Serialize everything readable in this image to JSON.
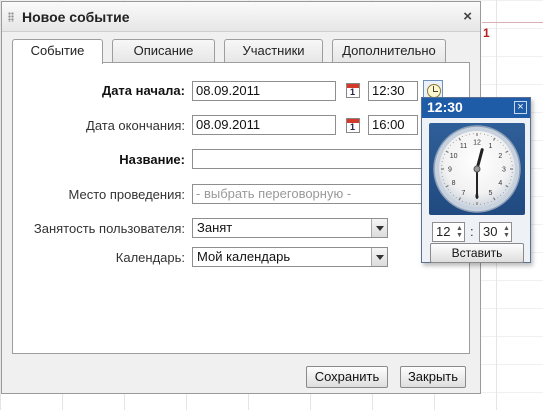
{
  "background": {
    "calendar_day_number": "1"
  },
  "dialog": {
    "title": "Новое событие",
    "close_symbol": "×",
    "tabs": [
      {
        "label": "Событие",
        "active": true
      },
      {
        "label": "Описание",
        "active": false
      },
      {
        "label": "Участники",
        "active": false
      },
      {
        "label": "Дополнительно",
        "active": false
      }
    ],
    "form": {
      "start_date_label": "Дата начала:",
      "start_date_value": "08.09.2011",
      "start_time_value": "12:30",
      "end_date_label": "Дата окончания:",
      "end_date_value": "08.09.2011",
      "end_time_value": "16:00",
      "calendar_icon_text": "1",
      "title_label": "Название:",
      "title_value": "",
      "place_label": "Место проведения:",
      "place_placeholder": "- выбрать переговорную -",
      "busy_label": "Занятость пользователя:",
      "busy_value": "Занят",
      "calendar_label": "Календарь:",
      "calendar_value": "Мой календарь"
    },
    "buttons": {
      "save": "Сохранить",
      "close": "Закрыть"
    }
  },
  "clock_popup": {
    "time": "12:30",
    "close_symbol": "×",
    "hours": "12",
    "minutes": "30",
    "separator": ":",
    "insert_button": "Вставить",
    "face_numbers": [
      "12",
      "1",
      "2",
      "3",
      "4",
      "5",
      "6",
      "7",
      "8",
      "9",
      "10",
      "11"
    ],
    "hand_hour": 12,
    "hand_minute": 30
  },
  "colors": {
    "accent": "#1f5ca7",
    "calendar_icon": "#d43a2a"
  }
}
